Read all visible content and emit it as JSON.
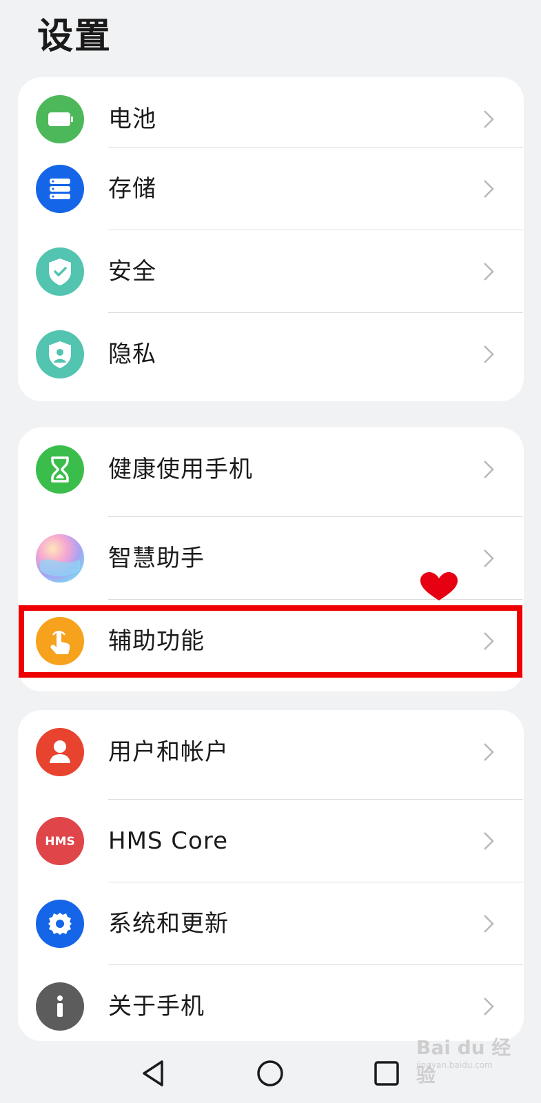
{
  "header": {
    "title": "设置"
  },
  "groups": [
    {
      "items": [
        {
          "label": "电池",
          "icon": "battery-icon",
          "color": "#4cb85a"
        },
        {
          "label": "存储",
          "icon": "storage-icon",
          "color": "#1565e8"
        },
        {
          "label": "安全",
          "icon": "security-shield-icon",
          "color": "#52c4b0"
        },
        {
          "label": "隐私",
          "icon": "privacy-shield-icon",
          "color": "#52c4b0"
        }
      ]
    },
    {
      "items": [
        {
          "label": "健康使用手机",
          "icon": "hourglass-icon",
          "color": "#3bbd4c"
        },
        {
          "label": "智慧助手",
          "icon": "assistant-orb-icon",
          "color": "#c7a4f0"
        },
        {
          "label": "辅助功能",
          "icon": "accessibility-hand-icon",
          "color": "#f6a21c"
        }
      ]
    },
    {
      "items": [
        {
          "label": "用户和帐户",
          "icon": "user-icon",
          "color": "#e8432f"
        },
        {
          "label": "HMS Core",
          "icon": "hms-core-icon",
          "icon_text": "HMS",
          "color": "#e0454a"
        },
        {
          "label": "系统和更新",
          "icon": "gear-icon",
          "color": "#1565e8"
        },
        {
          "label": "关于手机",
          "icon": "info-icon",
          "color": "#5c5c5c"
        }
      ]
    }
  ],
  "annotation": {
    "highlight_color": "#ee0000"
  },
  "watermark": {
    "text": "Bai du 经验",
    "sub": "jingyan.baidu.com"
  }
}
